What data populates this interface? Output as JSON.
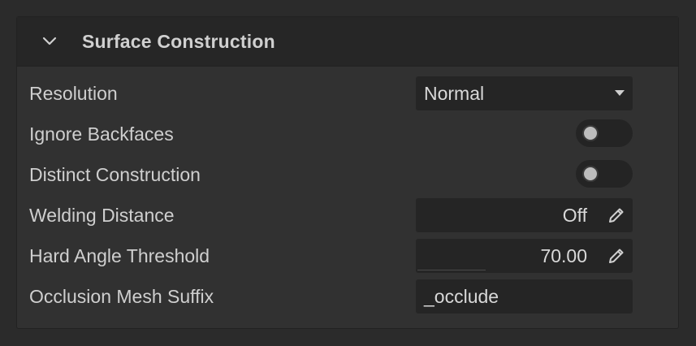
{
  "panel": {
    "title": "Surface Construction",
    "chevron_icon": "chevron-down-icon"
  },
  "rows": {
    "resolution": {
      "label": "Resolution",
      "value": "Normal",
      "icon": "caret-down-icon"
    },
    "ignore_backfaces": {
      "label": "Ignore Backfaces",
      "state": "off"
    },
    "distinct_construction": {
      "label": "Distinct Construction",
      "state": "off"
    },
    "welding_distance": {
      "label": "Welding Distance",
      "value": "Off",
      "icon": "pencil-icon"
    },
    "hard_angle_threshold": {
      "label": "Hard Angle Threshold",
      "value": "70.00",
      "icon": "pencil-icon"
    },
    "occlusion_mesh_suffix": {
      "label": "Occlusion Mesh Suffix",
      "value": "_occlude"
    }
  },
  "colors": {
    "background": "#2b2b2b",
    "panel": "#313131",
    "header": "#262626",
    "field": "#252525",
    "text": "#cfcfcf"
  }
}
